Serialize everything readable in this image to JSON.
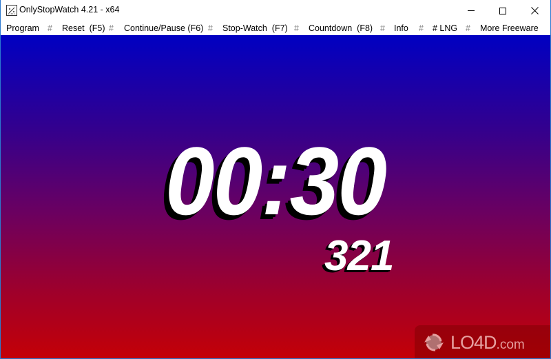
{
  "window": {
    "title": "OnlyStopWatch 4.21 - x64",
    "app_icon": "stopwatch-app-icon",
    "controls": {
      "minimize": "minimize-icon",
      "maximize": "maximize-icon",
      "close": "close-icon"
    }
  },
  "menu": {
    "separator": "#",
    "items": [
      {
        "label": "Program"
      },
      {
        "label": "Reset  (F5)"
      },
      {
        "label": "Continue/Pause (F6)"
      },
      {
        "label": "Stop-Watch  (F7)"
      },
      {
        "label": "Countdown  (F8)"
      },
      {
        "label": "Info"
      },
      {
        "label": "# LNG"
      },
      {
        "label": "More Freeware"
      }
    ]
  },
  "display": {
    "time": "00:30",
    "milliseconds": "321",
    "colors": {
      "gradient_top": "#0000c2",
      "gradient_middle": "#6b0060",
      "gradient_bottom": "#c40006",
      "digits": "#ffffff",
      "digit_shadow": "#000000"
    }
  },
  "watermark": {
    "text_main": "LO4D",
    "text_suffix": ".com"
  }
}
